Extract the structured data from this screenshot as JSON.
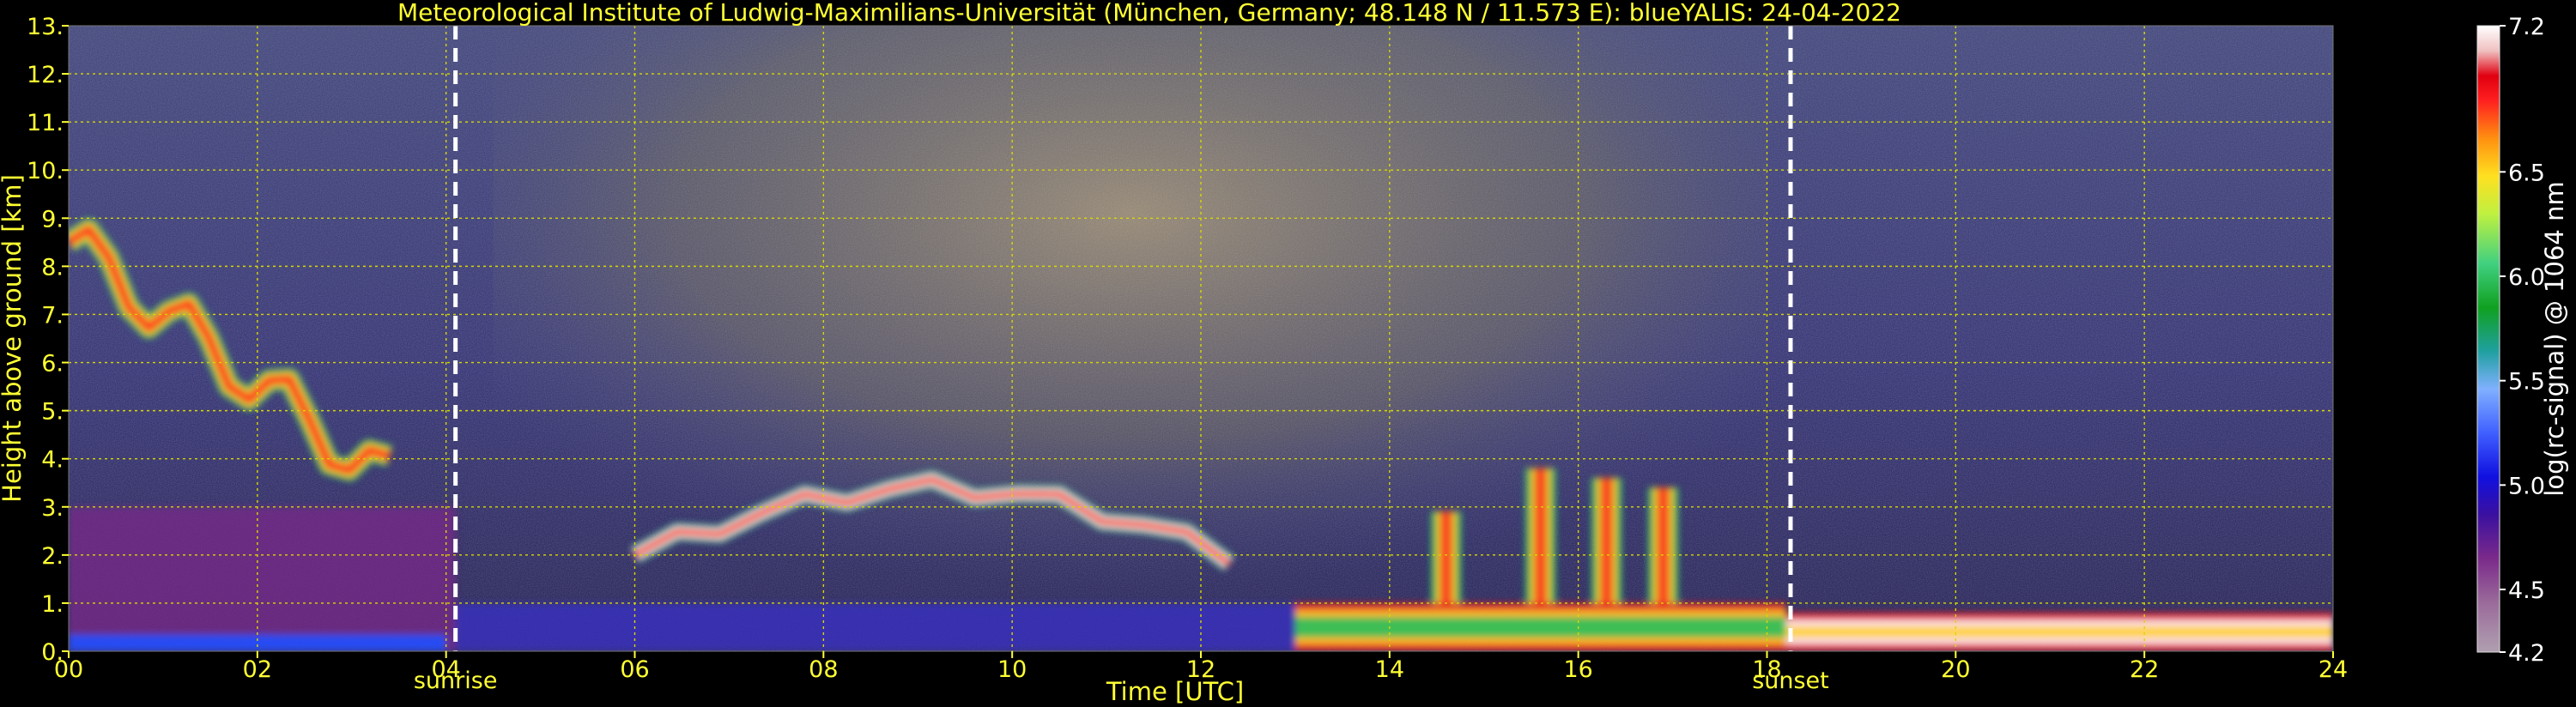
{
  "chart_data": {
    "type": "heatmap",
    "title": "Meteorological Institute of Ludwig-Maximilians-Universität (München, Germany; 48.148 N / 11.573 E):    blueYALIS: 24-04-2022",
    "xlabel": "Time [UTC]",
    "ylabel": "Height above ground [km]",
    "xlim": [
      0,
      24
    ],
    "ylim": [
      0,
      13
    ],
    "x_ticks": [
      0,
      2,
      4,
      6,
      8,
      10,
      12,
      14,
      16,
      18,
      20,
      22,
      24
    ],
    "x_tick_labels": [
      "00",
      "02",
      "04",
      "06",
      "08",
      "10",
      "12",
      "14",
      "16",
      "18",
      "20",
      "22",
      "24"
    ],
    "y_ticks": [
      0,
      1,
      2,
      3,
      4,
      5,
      6,
      7,
      8,
      9,
      10,
      11,
      12,
      13
    ],
    "y_tick_labels": [
      "0.",
      "1.",
      "2.",
      "3.",
      "4.",
      "5.",
      "6.",
      "7.",
      "8.",
      "9.",
      "10.",
      "11.",
      "12.",
      "13."
    ],
    "grid": true,
    "events": [
      {
        "label": "sunrise",
        "time": 4.1
      },
      {
        "label": "sunset",
        "time": 18.25
      }
    ],
    "colorbar": {
      "label": "log(rc-signal) @ 1064 nm",
      "range": [
        4.2,
        7.2
      ],
      "ticks": [
        4.2,
        4.5,
        5.0,
        5.5,
        6.0,
        6.5,
        7.2
      ],
      "tick_labels": [
        "4.2",
        "4.5",
        "5.0",
        "5.5",
        "6.0",
        "6.5",
        "7.2"
      ]
    },
    "features": [
      {
        "name": "elevated cloud layer",
        "t_start": 0,
        "t_end": 3.4,
        "h_low": 3.5,
        "h_high": 8.5
      },
      {
        "name": "aerosol layer",
        "t_start": 6,
        "t_end": 12.3,
        "h_low": 1.8,
        "h_high": 4.0
      },
      {
        "name": "boundary layer",
        "t_start": 13,
        "t_end": 18.2,
        "h_low": 0.0,
        "h_high": 1.0
      },
      {
        "name": "convective plumes",
        "t_start": 14.5,
        "t_end": 17.2,
        "h_low": 1.0,
        "h_high": 3.8
      },
      {
        "name": "nocturnal surface layer",
        "t_start": 18.2,
        "t_end": 24,
        "h_low": 0.0,
        "h_high": 0.8
      }
    ]
  }
}
